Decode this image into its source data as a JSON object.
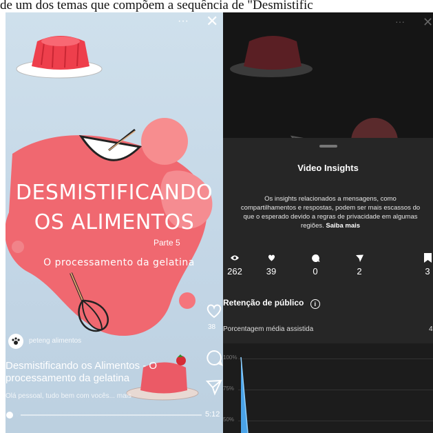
{
  "caption": "de um dos temas que compõem a sequência de \"Desmistific",
  "reel": {
    "more_label": "···",
    "close_label": "✕",
    "title_line1": "DESMISTIFICANDO",
    "title_line2": "OS ALIMENTOS",
    "part": "Parte 5",
    "subtitle": "O processamento da gelatina",
    "account": "peteng alimentos",
    "post_title_line1": "Desmistificando os Alimentos - O",
    "post_title_line2": "processamento da gelatina",
    "description": "Olá pessoal, tudo bem com vocês... mais",
    "like_count": "38",
    "time": "5:12"
  },
  "insights": {
    "title": "Video Insights",
    "notice": "Os insights relacionados a mensagens, como compartilhamentos e respostas, podem ser mais escassos do que o esperado devido a regras de privacidade em algumas regiões.",
    "learn_more": "Saiba mais",
    "stats": [
      {
        "icon": "eye-icon",
        "value": "262"
      },
      {
        "icon": "heart-icon",
        "value": "39"
      },
      {
        "icon": "comment-icon",
        "value": "0"
      },
      {
        "icon": "share-icon",
        "value": "2"
      },
      {
        "icon": "bookmark-icon",
        "value": "3"
      }
    ],
    "retention_label": "Retenção de público",
    "info_icon": "info-icon",
    "avg_watched_label": "Porcentagem média assistida",
    "avg_watched_value": "4",
    "axis_labels": [
      "100%",
      "75%",
      "50%"
    ]
  },
  "colors": {
    "accent_red": "#e43d4e",
    "panel_bg": "#262626",
    "chart_blue": "#4aa3e8"
  }
}
